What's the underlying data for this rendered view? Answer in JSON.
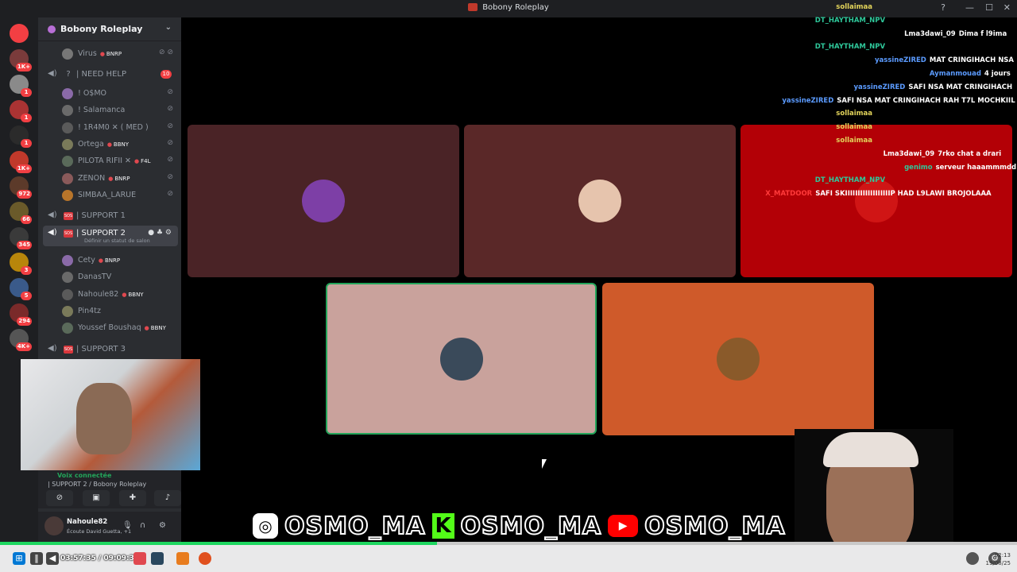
{
  "window": {
    "title": "Bobony Roleplay"
  },
  "server_badges": [
    "1K+",
    "1",
    "1",
    "1",
    "1K+",
    "972",
    "66",
    "345",
    "3",
    "5",
    "294",
    "4K+"
  ],
  "sidebar": {
    "guild_name": "Bobony Roleplay",
    "top_members": [
      {
        "name": "Virus",
        "tag": "BNRP"
      }
    ],
    "need_help": {
      "label": "| NEED HELP",
      "count": "10"
    },
    "need_help_members": [
      {
        "name": "! O$MO",
        "tag": ""
      },
      {
        "name": "! Salamanca",
        "tag": ""
      },
      {
        "name": "! 1R4M0 ✕ ( MED )",
        "tag": ""
      },
      {
        "name": "Ortega",
        "tag": "BBNY"
      },
      {
        "name": "PILOTA RIFII ✕",
        "tag": "F4L"
      },
      {
        "name": "ZENON",
        "tag": "BNRP"
      },
      {
        "name": "SIMBAA_LARUE",
        "tag": ""
      }
    ],
    "support1": "| SUPPORT 1",
    "support2": "| SUPPORT 2",
    "support2_status": "Définir un statut de salon",
    "support2_members": [
      {
        "name": "Cety",
        "tag": "BNRP"
      },
      {
        "name": "DanasTV",
        "tag": ""
      },
      {
        "name": "Nahoule82",
        "tag": "BBNY"
      },
      {
        "name": "Pin4tz",
        "tag": ""
      },
      {
        "name": "Youssef Boushaq",
        "tag": "BBNY"
      }
    ],
    "support3": "| SUPPORT 3"
  },
  "voice_status": {
    "connected": "Voix connectée",
    "location": "| SUPPORT 2 / Bobony Roleplay"
  },
  "user_panel": {
    "name": "Nahoule82",
    "status": "Écoute David Guetta,",
    "extra": "+1"
  },
  "tiles": [
    {
      "color": "#4a2326",
      "avatar": "#7d3fa6"
    },
    {
      "color": "#5a2828",
      "avatar": "#e6c4ad"
    },
    {
      "color": "#b30006",
      "avatar": "#d01515"
    },
    {
      "color": "#c9a29c",
      "avatar": "#3a4a5a",
      "speaking": true
    },
    {
      "color": "#cf5a2a",
      "avatar": "#8a5a2a"
    }
  ],
  "chat": [
    {
      "user": "sollaimaa",
      "text": "",
      "color": "#e3d45b"
    },
    {
      "user": "DT_HAYTHAM_NPV",
      "text": "",
      "color": "#2fc89b"
    },
    {
      "user": "Lma3dawi_09",
      "text": "Dima f l9ima",
      "color": "#ffffff"
    },
    {
      "user": "DT_HAYTHAM_NPV",
      "text": "",
      "color": "#2fc89b"
    },
    {
      "user": "yassineZIRED",
      "text": "MAT CRINGIHACH NSA",
      "color": "#5b9bff"
    },
    {
      "user": "Aymanmouad",
      "text": "4 jours",
      "color": "#5b9bff"
    },
    {
      "user": "yassineZIRED",
      "text": "SAFI NSA MAT CRINGIHACH",
      "color": "#5b9bff"
    },
    {
      "user": "yassineZIRED",
      "text": "SAFI NSA MAT CRINGIHACH RAH T7L MOCHKIIL",
      "color": "#5b9bff"
    },
    {
      "user": "sollaimaa",
      "text": "",
      "color": "#e3d45b"
    },
    {
      "user": "sollaimaa",
      "text": "",
      "color": "#e3d45b"
    },
    {
      "user": "sollaimaa",
      "text": "",
      "color": "#e3d45b"
    },
    {
      "user": "Lma3dawi_09",
      "text": "7rko chat a drari",
      "color": "#ffffff"
    },
    {
      "user": "genimo",
      "text": "serveur haaammmdd",
      "color": "#2fc89b"
    },
    {
      "user": "DT_HAYTHAM_NPV",
      "text": "",
      "color": "#2fc89b"
    },
    {
      "user": "X_MATDOOR",
      "text": "SAFI SKIIIIIIIIIIIIIIIIIIP HAD L9LAWI BROJOLAAA",
      "color": "#ff3a3a"
    }
  ],
  "banner": {
    "handle": "OSMO_MA",
    "kick_letter": "K",
    "ig_glyph": "◎",
    "yt_glyph": "▶"
  },
  "taskbar": {
    "elapsed": "03:57:35 / 09:09:32",
    "progress": 0.43,
    "time": "02:13",
    "date": "19/08/25"
  }
}
